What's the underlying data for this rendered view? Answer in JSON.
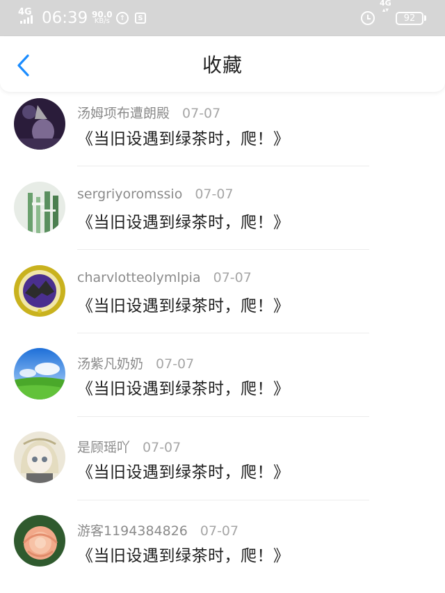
{
  "status_bar": {
    "network_left": "4G",
    "time": "06:39",
    "speed_value": "90.0",
    "speed_unit": "KB/s",
    "network_right": "4G",
    "battery": "92"
  },
  "header": {
    "title": "收藏"
  },
  "favorites": [
    {
      "author": "汤姆项布遭朗殿",
      "date": "07-07",
      "title": "《当旧设遇到绿茶时，爬！》"
    },
    {
      "author": "sergriyoromssio",
      "date": "07-07",
      "title": "《当旧设遇到绿茶时，爬！》"
    },
    {
      "author": "charvlotteolymlpia",
      "date": "07-07",
      "title": "《当旧设遇到绿茶时，爬！》"
    },
    {
      "author": "汤紫凡奶奶",
      "date": "07-07",
      "title": "《当旧设遇到绿茶时，爬！》"
    },
    {
      "author": "是顾瑶吖",
      "date": "07-07",
      "title": "《当旧设遇到绿茶时，爬！》"
    },
    {
      "author": "游客1194384826",
      "date": "07-07",
      "title": "《当旧设遇到绿茶时，爬！》"
    }
  ],
  "colors": {
    "accent": "#1a8cff",
    "status_bar_bg": "#d6d6d6"
  }
}
